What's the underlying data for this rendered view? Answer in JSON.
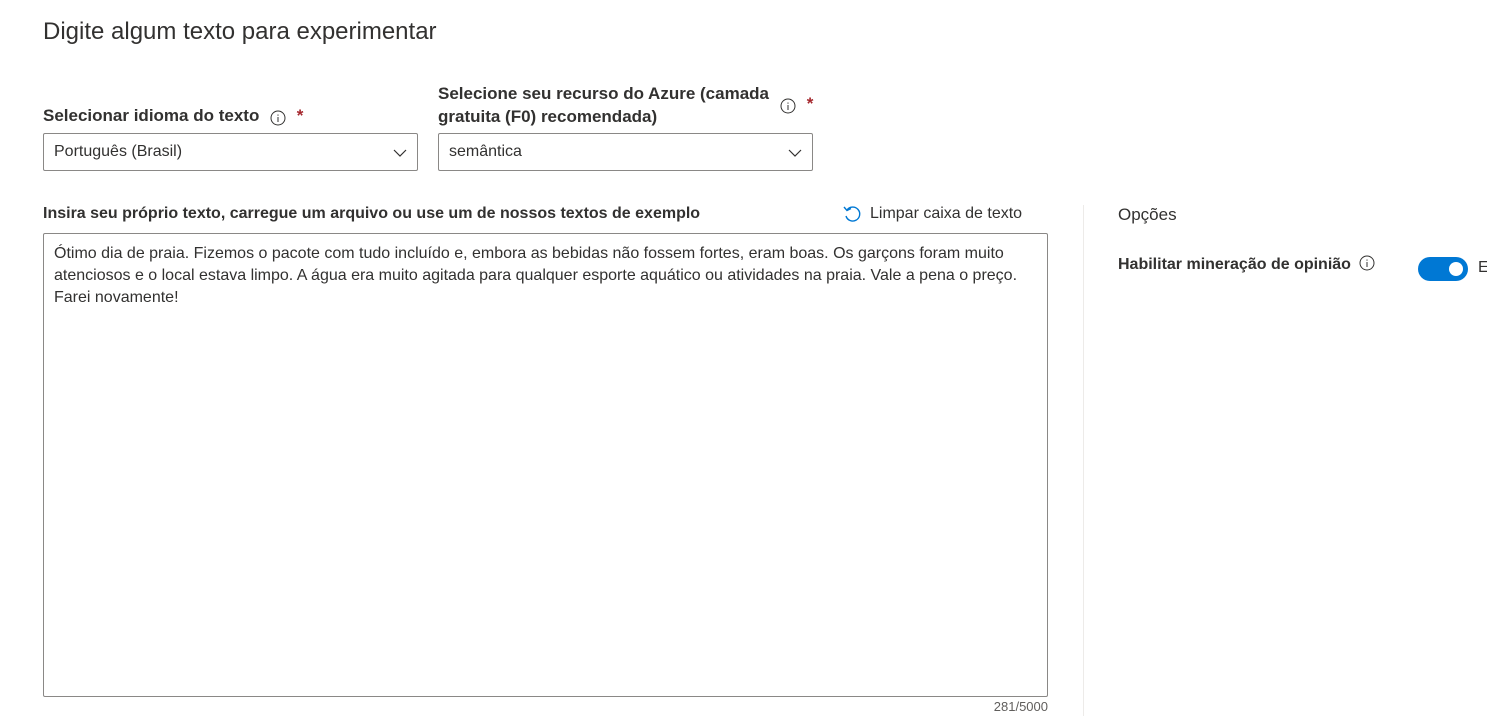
{
  "page_title": "Digite algum texto para experimentar",
  "language": {
    "label": "Selecionar idioma do texto",
    "required_mark": "*",
    "selected": "Português (Brasil)"
  },
  "resource": {
    "label_line1": "Selecione seu recurso do Azure (camada",
    "label_line2": "gratuita (F0) recomendada)",
    "required_mark": "*",
    "selected": "semântica"
  },
  "input_section": {
    "label": "Insira seu próprio texto, carregue um arquivo ou use um de nossos textos de exemplo",
    "clear_button": "Limpar caixa de texto",
    "text": "Ótimo dia de praia. Fizemos o pacote com tudo incluído e, embora as bebidas não fossem fortes, eram boas. Os garçons foram muito atenciosos e o local estava limpo. A água era muito agitada para qualquer esporte aquático ou atividades na praia. Vale a pena o preço. Farei novamente!",
    "counter": "281/5000"
  },
  "options": {
    "heading": "Opções",
    "opinion_mining": {
      "label": "Habilitar mineração de opinião",
      "enabled": true,
      "state_text": "E"
    }
  },
  "colors": {
    "accent": "#0078d4",
    "required": "#a4262c",
    "border": "#8a8886"
  }
}
